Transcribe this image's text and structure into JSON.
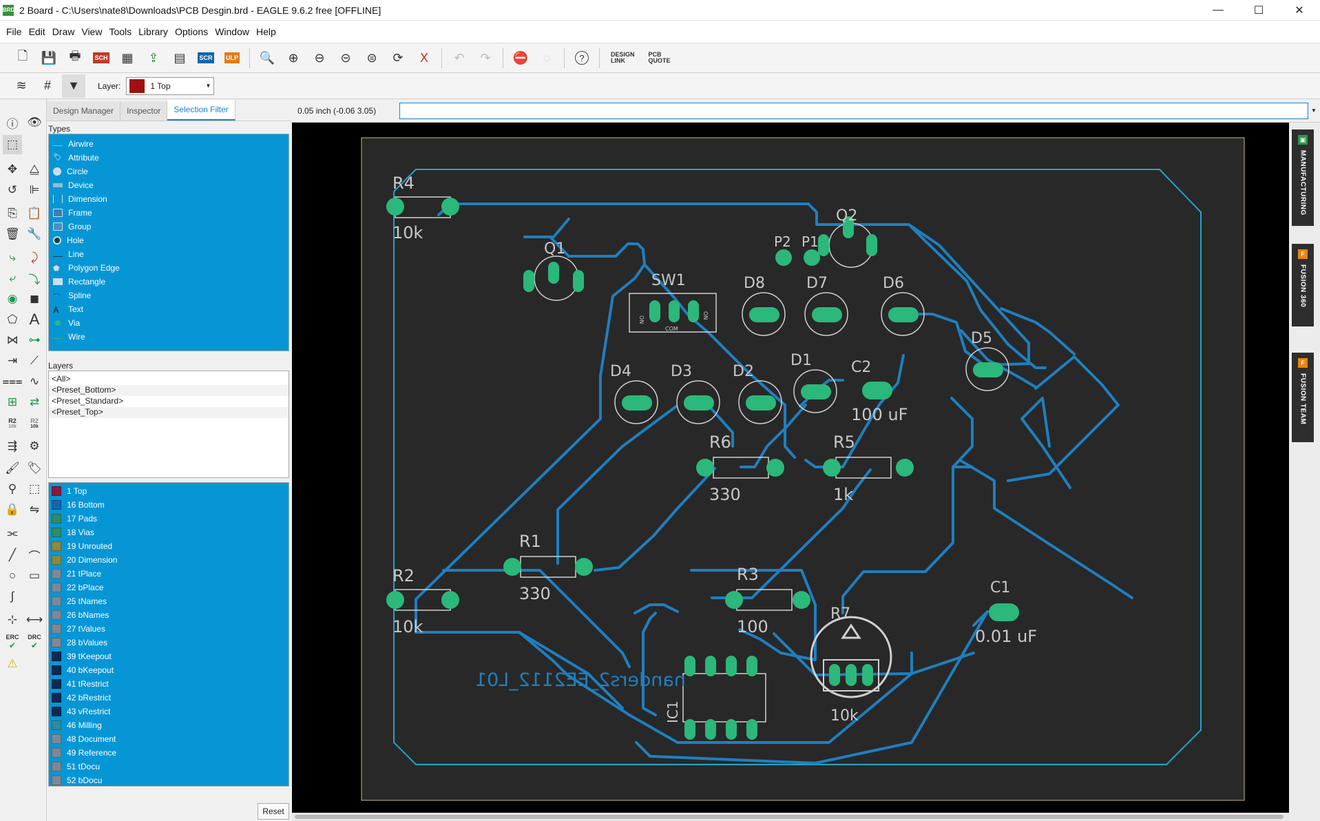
{
  "window": {
    "title": "2 Board - C:\\Users\\nate8\\Downloads\\PCB Desgin.brd - EAGLE 9.6.2 free [OFFLINE]",
    "app_icon": "BRD",
    "minimize": "—",
    "maximize": "☐",
    "close": "✕"
  },
  "menu": [
    "File",
    "Edit",
    "Draw",
    "View",
    "Tools",
    "Library",
    "Options",
    "Window",
    "Help"
  ],
  "toolbar": {
    "sch_label": "SCH",
    "scr_label": "SCR",
    "ulp_label": "ULP",
    "design_link": "DESIGN\nLINK",
    "design_link_1": "DESIGN",
    "design_link_2": "LINK",
    "pcb_quote_1": "PCB",
    "pcb_quote_2": "QUOTE",
    "help": "?"
  },
  "layerbar": {
    "label": "Layer:",
    "selected": "1 Top",
    "selected_color": "#a01010"
  },
  "left_tools": {
    "r2": "R2",
    "r2_sub": "10k",
    "erc": "ERC",
    "drc": "DRC"
  },
  "panel": {
    "tabs": [
      "Design Manager",
      "Inspector",
      "Selection Filter"
    ],
    "active_tab": "Selection Filter",
    "types_label": "Types",
    "types": [
      "Airwire",
      "Attribute",
      "Circle",
      "Device",
      "Dimension",
      "Frame",
      "Group",
      "Hole",
      "Line",
      "Polygon Edge",
      "Rectangle",
      "Spline",
      "Text",
      "Via",
      "Wire"
    ],
    "layers_label": "Layers",
    "layer_presets": [
      "<All>",
      "<Preset_Bottom>",
      "<Preset_Standard>",
      "<Preset_Top>"
    ],
    "layers": [
      {
        "name": "1 Top",
        "color": "#8b1a3a"
      },
      {
        "name": "16 Bottom",
        "color": "#1565a8"
      },
      {
        "name": "17 Pads",
        "color": "#2d8c6e"
      },
      {
        "name": "18 Vias",
        "color": "#2d8c6e"
      },
      {
        "name": "19 Unrouted",
        "color": "#8a8a40"
      },
      {
        "name": "20 Dimension",
        "color": "#8a8a40"
      },
      {
        "name": "21 tPlace",
        "color": "#7a8a9a"
      },
      {
        "name": "22 bPlace",
        "color": "#7a8a9a"
      },
      {
        "name": "25 tNames",
        "color": "#7a8a9a"
      },
      {
        "name": "26 bNames",
        "color": "#7a8a9a"
      },
      {
        "name": "27 tValues",
        "color": "#7a8a9a"
      },
      {
        "name": "28 bValues",
        "color": "#7a8a9a"
      },
      {
        "name": "39 tKeepout",
        "color": "#0b2a55"
      },
      {
        "name": "40 bKeepout",
        "color": "#0b2a55"
      },
      {
        "name": "41 tRestrict",
        "color": "#0b2a55"
      },
      {
        "name": "42 bRestrict",
        "color": "#0b2a55"
      },
      {
        "name": "43 vRestrict",
        "color": "#0b2a55"
      },
      {
        "name": "46 Milling",
        "color": "#2d8ca0"
      },
      {
        "name": "48 Document",
        "color": "#7a8a9a"
      },
      {
        "name": "49 Reference",
        "color": "#7a8a9a"
      },
      {
        "name": "51 tDocu",
        "color": "#7a8a9a"
      },
      {
        "name": "52 bDocu",
        "color": "#7a8a9a"
      }
    ],
    "reset": "Reset"
  },
  "coord": {
    "readout": "0.05 inch (-0.06 3.05)",
    "command_value": ""
  },
  "board": {
    "labels": {
      "R4": "R4",
      "R4v": "10k",
      "Q1": "Q1",
      "Q2": "Q2",
      "P2": "P2",
      "P1": "P1",
      "SW1": "SW1",
      "on1": "ON",
      "com": "COM",
      "on2": "ON",
      "D8": "D8",
      "D7": "D7",
      "D6": "D6",
      "D5": "D5",
      "D4": "D4",
      "D3": "D3",
      "D2": "D2",
      "D1": "D1",
      "C2": "C2",
      "C2v": "100 uF",
      "R6": "R6",
      "R6v": "330",
      "R5": "R5",
      "R5v": "1k",
      "R1": "R1",
      "R1v": "330",
      "R2": "R2",
      "R2v": "10k",
      "R3": "R3",
      "R3v": "100",
      "R7": "R7",
      "R7v": "10k",
      "C1": "C1",
      "C1v": "0.01 uF",
      "IC1": "IC1",
      "silk": "nanders2_EE2112_L01"
    },
    "trace_color": "#1f7fc0",
    "pad_color": "#2bb87a",
    "outline_color": "#21a6c4"
  },
  "right_rail": [
    "MANUFACTURING",
    "FUSION 360",
    "FUSION TEAM"
  ]
}
